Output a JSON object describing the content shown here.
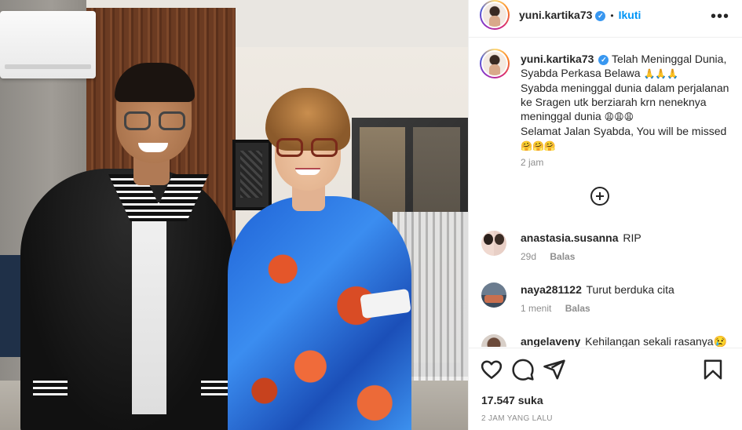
{
  "post": {
    "username": "yuni.kartika73",
    "follow_label": "Ikuti",
    "more_label": "•••",
    "caption_line1": "Telah Meninggal Dunia, Syabda Perkasa Belawa",
    "caption_emoji1": "🙏🙏🙏",
    "caption_line2": "Syabda meninggal dunia dalam perjalanan ke Sragen utk berziarah krn neneknya meninggal dunia",
    "caption_emoji2": "😩😩😩",
    "caption_line3": "Selamat Jalan Syabda, You will be missed",
    "caption_emoji3": "🤗🤗🤗",
    "caption_time": "2 jam",
    "likes": "17.547 suka",
    "timestamp": "2 JAM YANG LALU"
  },
  "comments": [
    {
      "username": "anastasia.susanna",
      "text": "RIP",
      "time": "29d",
      "reply": "Balas"
    },
    {
      "username": "naya281122",
      "text": "Turut berduka cita",
      "time": "1 menit",
      "reply": "Balas"
    },
    {
      "username": "angelaveny",
      "text": "Kehilangan sekali rasanya😢"
    }
  ],
  "icons": {
    "like": "heart-icon",
    "comment": "comment-icon",
    "share": "paper-plane-icon",
    "save": "bookmark-icon",
    "more": "more-options-icon",
    "load_more": "plus-circle-icon"
  },
  "colors": {
    "follow": "#0095f6",
    "verified": "#3897f0",
    "muted": "#8e8e8e",
    "text": "#262626"
  }
}
